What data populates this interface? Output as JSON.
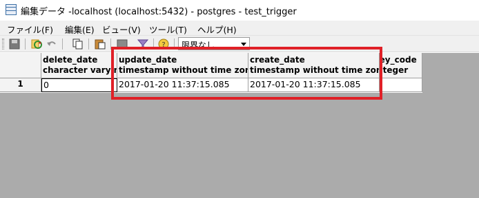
{
  "window": {
    "title": "編集データ -localhost (localhost:5432) - postgres - test_trigger"
  },
  "menu": {
    "items": [
      "ファイル(F)",
      "編集(E)",
      "ビュー(V)",
      "ツール(T)",
      "ヘルプ(H)"
    ]
  },
  "toolbar": {
    "limit_value": "限界なし",
    "icons": [
      "save-icon",
      "refresh-icon",
      "undo-icon",
      "copy-icon",
      "paste-icon",
      "delete-row-icon",
      "filter-icon",
      "help-icon"
    ]
  },
  "grid": {
    "columns": [
      {
        "name": "delete_date",
        "type": "character varying"
      },
      {
        "name": "update_date",
        "type": "timestamp without time zone"
      },
      {
        "name": "create_date",
        "type": "timestamp without time zone"
      },
      {
        "name": "key_code",
        "type": "integer"
      }
    ],
    "rows": [
      {
        "row_number": "1",
        "cells": [
          "0",
          "2017-01-20 11:37:15.085",
          "2017-01-20 11:37:15.085",
          ""
        ]
      }
    ]
  },
  "colors": {
    "highlight": "#e02027",
    "grid_background": "#ababab",
    "header_background": "#f3f3f3"
  }
}
